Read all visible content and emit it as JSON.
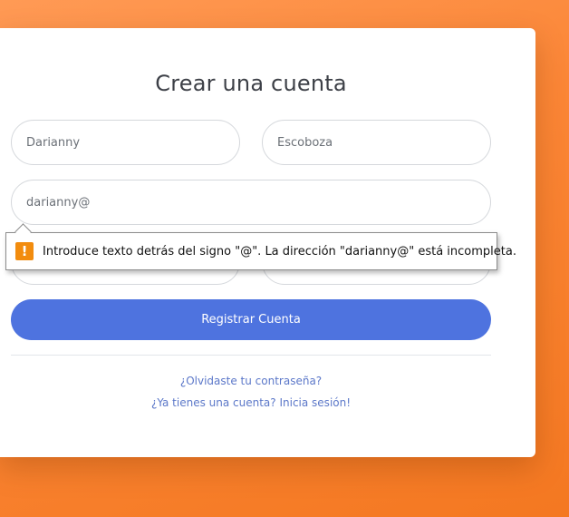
{
  "form": {
    "title": "Crear una cuenta",
    "first_name": {
      "value": "Darianny"
    },
    "last_name": {
      "value": "Escoboza"
    },
    "email": {
      "value": "darianny@"
    },
    "submit_label": "Registrar Cuenta",
    "forgot_password_link": "¿Olvidaste tu contraseña?",
    "login_link": "¿Ya tienes una cuenta? Inicia sesión!"
  },
  "validation_tooltip": {
    "icon": "warning-icon",
    "icon_glyph": "!",
    "icon_color": "#f28c0e",
    "message": "Introduce texto detrás del signo \"@\". La dirección \"darianny@\" está incompleta."
  },
  "colors": {
    "primary_button": "#4e73df",
    "link": "#5c78c9",
    "background_orange": "#fb8636"
  }
}
